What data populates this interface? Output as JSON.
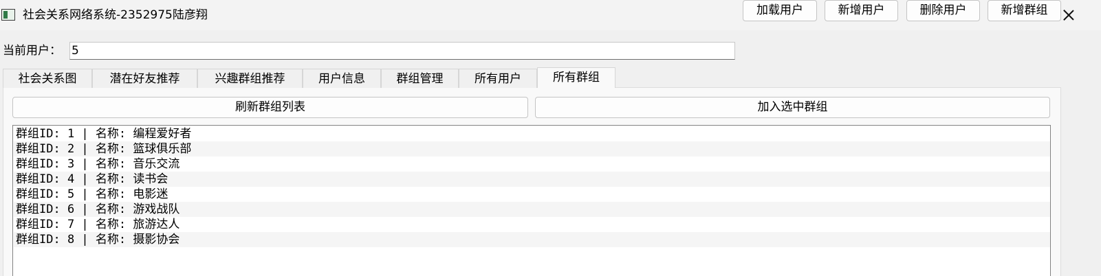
{
  "window": {
    "title": "社会关系网络系统-2352975陆彦翔"
  },
  "toolbar": {
    "current_user_label": "当前用户：",
    "current_user_value": "5",
    "buttons": [
      "加载用户",
      "新增用户",
      "删除用户",
      "新增群组"
    ]
  },
  "tabs": [
    "社会关系图",
    "潜在好友推荐",
    "兴趣群组推荐",
    "用户信息",
    "群组管理",
    "所有用户",
    "所有群组"
  ],
  "active_tab": "所有群组",
  "group_panel": {
    "refresh_button": "刷新群组列表",
    "join_button": "加入选中群组",
    "groups": [
      "群组ID: 1 | 名称: 编程爱好者",
      "群组ID: 2 | 名称: 篮球俱乐部",
      "群组ID: 3 | 名称: 音乐交流",
      "群组ID: 4 | 名称: 读书会",
      "群组ID: 5 | 名称: 电影迷",
      "群组ID: 6 | 名称: 游戏战队",
      "群组ID: 7 | 名称: 旅游达人",
      "群组ID: 8 | 名称: 摄影协会"
    ]
  },
  "icons": {
    "app": "app-window-icon",
    "minimize": "minimize-icon",
    "maximize": "maximize-icon",
    "close": "close-icon"
  }
}
